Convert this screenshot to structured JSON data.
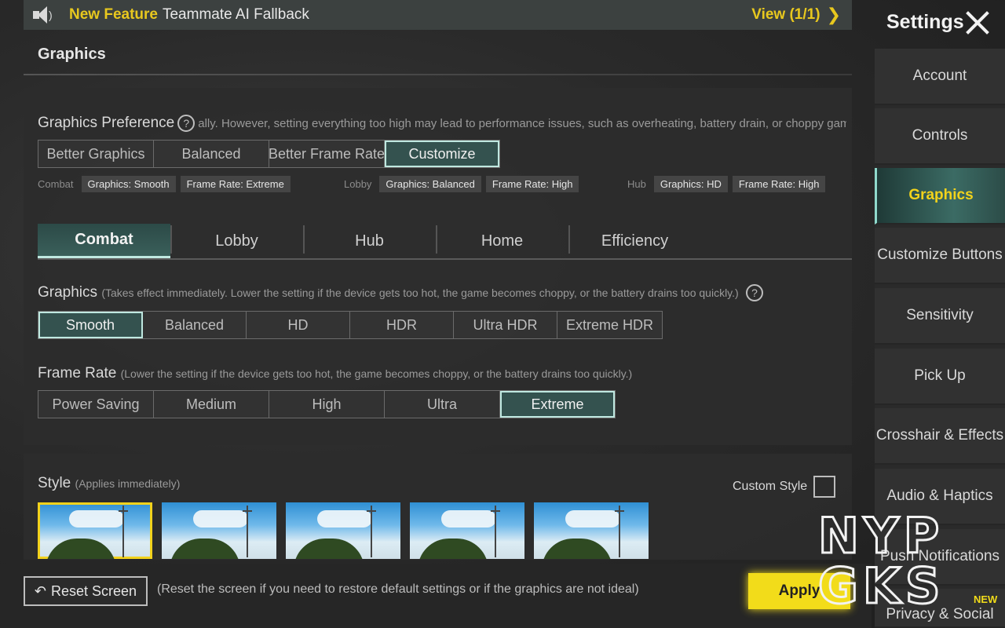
{
  "banner": {
    "tag": "New Feature",
    "message": "Teammate AI Fallback",
    "view_label": "View (1/1)"
  },
  "page_title": "Graphics",
  "graphics_preference": {
    "label": "Graphics Preference",
    "hint": "ally. However, setting everything too high may lead to performance issues, such as overheating, battery drain, or choppy gameplay",
    "options": [
      "Better Graphics",
      "Balanced",
      "Better Frame Rate",
      "Customize"
    ],
    "selected": "Customize"
  },
  "summary": {
    "combat": {
      "label": "Combat",
      "graphics": "Graphics: Smooth",
      "frame_rate": "Frame Rate: Extreme"
    },
    "lobby": {
      "label": "Lobby",
      "graphics": "Graphics: Balanced",
      "frame_rate": "Frame Rate: High"
    },
    "hub": {
      "label": "Hub",
      "graphics": "Graphics: HD",
      "frame_rate": "Frame Rate: High"
    }
  },
  "tabs": [
    "Combat",
    "Lobby",
    "Hub",
    "Home",
    "Efficiency"
  ],
  "active_tab": "Combat",
  "graphics": {
    "label": "Graphics",
    "hint": "(Takes effect immediately. Lower the setting if the device gets too hot, the game becomes choppy, or the battery drains too quickly.)",
    "options": [
      "Smooth",
      "Balanced",
      "HD",
      "HDR",
      "Ultra HDR",
      "Extreme HDR"
    ],
    "selected": "Smooth"
  },
  "frame_rate": {
    "label": "Frame Rate",
    "hint": "(Lower the setting if the device gets too hot, the game becomes choppy, or the battery drains too quickly.)",
    "options": [
      "Power Saving",
      "Medium",
      "High",
      "Ultra",
      "Extreme"
    ],
    "selected": "Extreme"
  },
  "style": {
    "label": "Style",
    "hint": "(Applies immediately)",
    "custom_label": "Custom Style"
  },
  "bottom": {
    "reset_label": "Reset Screen",
    "reset_note": "(Reset the screen if you need to restore default settings or if the graphics are not ideal)",
    "apply_label": "Apply"
  },
  "sidebar": {
    "title": "Settings",
    "items": [
      "Account",
      "Controls",
      "Graphics",
      "Customize Buttons",
      "Sensitivity",
      "Pick Up",
      "Crosshair & Effects",
      "Audio & Haptics",
      "Push Notifications",
      "Privacy & Social"
    ],
    "active": "Graphics",
    "new_badge": "NEW"
  },
  "watermark": {
    "line1": "NYP",
    "line2": "GKS"
  },
  "colors": {
    "accent_teal": "#34524f",
    "highlight_yellow": "#f2dc1a"
  }
}
